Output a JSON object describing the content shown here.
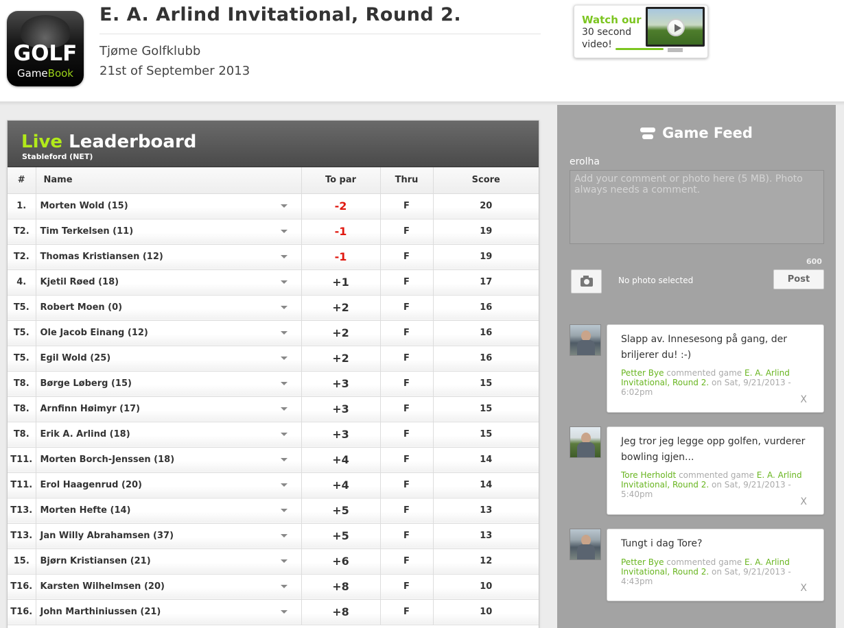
{
  "logo": {
    "line1": "GOLF",
    "line2a": "Game",
    "line2b": "Book"
  },
  "event": {
    "title": "E. A. Arlind Invitational, Round 2.",
    "club": "Tjøme Golfklubb",
    "date": "21st of September 2013"
  },
  "video_promo": {
    "line1": "Watch our",
    "line2": "30 second",
    "line3": "video!",
    "icon": "play-icon"
  },
  "leaderboard": {
    "title_live": "Live",
    "title_rest": "Leaderboard",
    "subtitle": "Stableford (NET)",
    "columns": {
      "rank": "#",
      "name": "Name",
      "to_par": "To par",
      "thru": "Thru",
      "score": "Score"
    },
    "rows": [
      {
        "rank": "1.",
        "name": "Morten Wold (15)",
        "to_par": "-2",
        "thru": "F",
        "score": "20"
      },
      {
        "rank": "T2.",
        "name": "Tim Terkelsen (11)",
        "to_par": "-1",
        "thru": "F",
        "score": "19"
      },
      {
        "rank": "T2.",
        "name": "Thomas Kristiansen (12)",
        "to_par": "-1",
        "thru": "F",
        "score": "19"
      },
      {
        "rank": "4.",
        "name": "Kjetil Røed (18)",
        "to_par": "+1",
        "thru": "F",
        "score": "17"
      },
      {
        "rank": "T5.",
        "name": "Robert Moen (0)",
        "to_par": "+2",
        "thru": "F",
        "score": "16"
      },
      {
        "rank": "T5.",
        "name": "Ole Jacob Einang (12)",
        "to_par": "+2",
        "thru": "F",
        "score": "16"
      },
      {
        "rank": "T5.",
        "name": "Egil Wold (25)",
        "to_par": "+2",
        "thru": "F",
        "score": "16"
      },
      {
        "rank": "T8.",
        "name": "Børge Løberg (15)",
        "to_par": "+3",
        "thru": "F",
        "score": "15"
      },
      {
        "rank": "T8.",
        "name": "Arnfinn Høimyr (17)",
        "to_par": "+3",
        "thru": "F",
        "score": "15"
      },
      {
        "rank": "T8.",
        "name": "Erik A. Arlind (18)",
        "to_par": "+3",
        "thru": "F",
        "score": "15"
      },
      {
        "rank": "T11.",
        "name": "Morten Borch-Jenssen (18)",
        "to_par": "+4",
        "thru": "F",
        "score": "14"
      },
      {
        "rank": "T11.",
        "name": "Erol Haagenrud (20)",
        "to_par": "+4",
        "thru": "F",
        "score": "14"
      },
      {
        "rank": "T13.",
        "name": "Morten Hefte (14)",
        "to_par": "+5",
        "thru": "F",
        "score": "13"
      },
      {
        "rank": "T13.",
        "name": "Jan Willy Abrahamsen (37)",
        "to_par": "+5",
        "thru": "F",
        "score": "13"
      },
      {
        "rank": "15.",
        "name": "Bjørn Kristiansen (21)",
        "to_par": "+6",
        "thru": "F",
        "score": "12"
      },
      {
        "rank": "T16.",
        "name": "Karsten Wilhelmsen (20)",
        "to_par": "+8",
        "thru": "F",
        "score": "10"
      },
      {
        "rank": "T16.",
        "name": "John Marthiniussen (21)",
        "to_par": "+8",
        "thru": "F",
        "score": "10"
      }
    ]
  },
  "feed": {
    "title": "Game Feed",
    "user": "erolha",
    "placeholder": "Add your comment or photo here (5 MB). Photo always needs a comment.",
    "char_count": "600",
    "no_photo": "No photo selected",
    "post_label": "Post",
    "items": [
      {
        "text": "Slapp av. Innesesong på gang, der briljerer du! :-)",
        "author": "Petter Bye",
        "verb": "commented game",
        "game": "E. A. Arlind Invitational, Round 2.",
        "when": "on Sat, 9/21/2013 - 6:02pm",
        "close": "X"
      },
      {
        "text": "Jeg tror jeg legge opp golfen, vurderer bowling igjen...",
        "author": "Tore Herholdt",
        "verb": "commented game",
        "game": "E. A. Arlind Invitational, Round 2.",
        "when": "on Sat, 9/21/2013 - 5:40pm",
        "close": "X"
      },
      {
        "text": "Tungt i dag Tore?",
        "author": "Petter Bye",
        "verb": "commented game",
        "game": "E. A. Arlind Invitational, Round 2.",
        "when": "on Sat, 9/21/2013 - 4:43pm",
        "close": "X"
      }
    ]
  },
  "colors": {
    "live_green": "#b2ea1a",
    "negative_red": "#e0180f",
    "link_green": "#68b51f",
    "feed_bg": "#a3a3a3"
  }
}
